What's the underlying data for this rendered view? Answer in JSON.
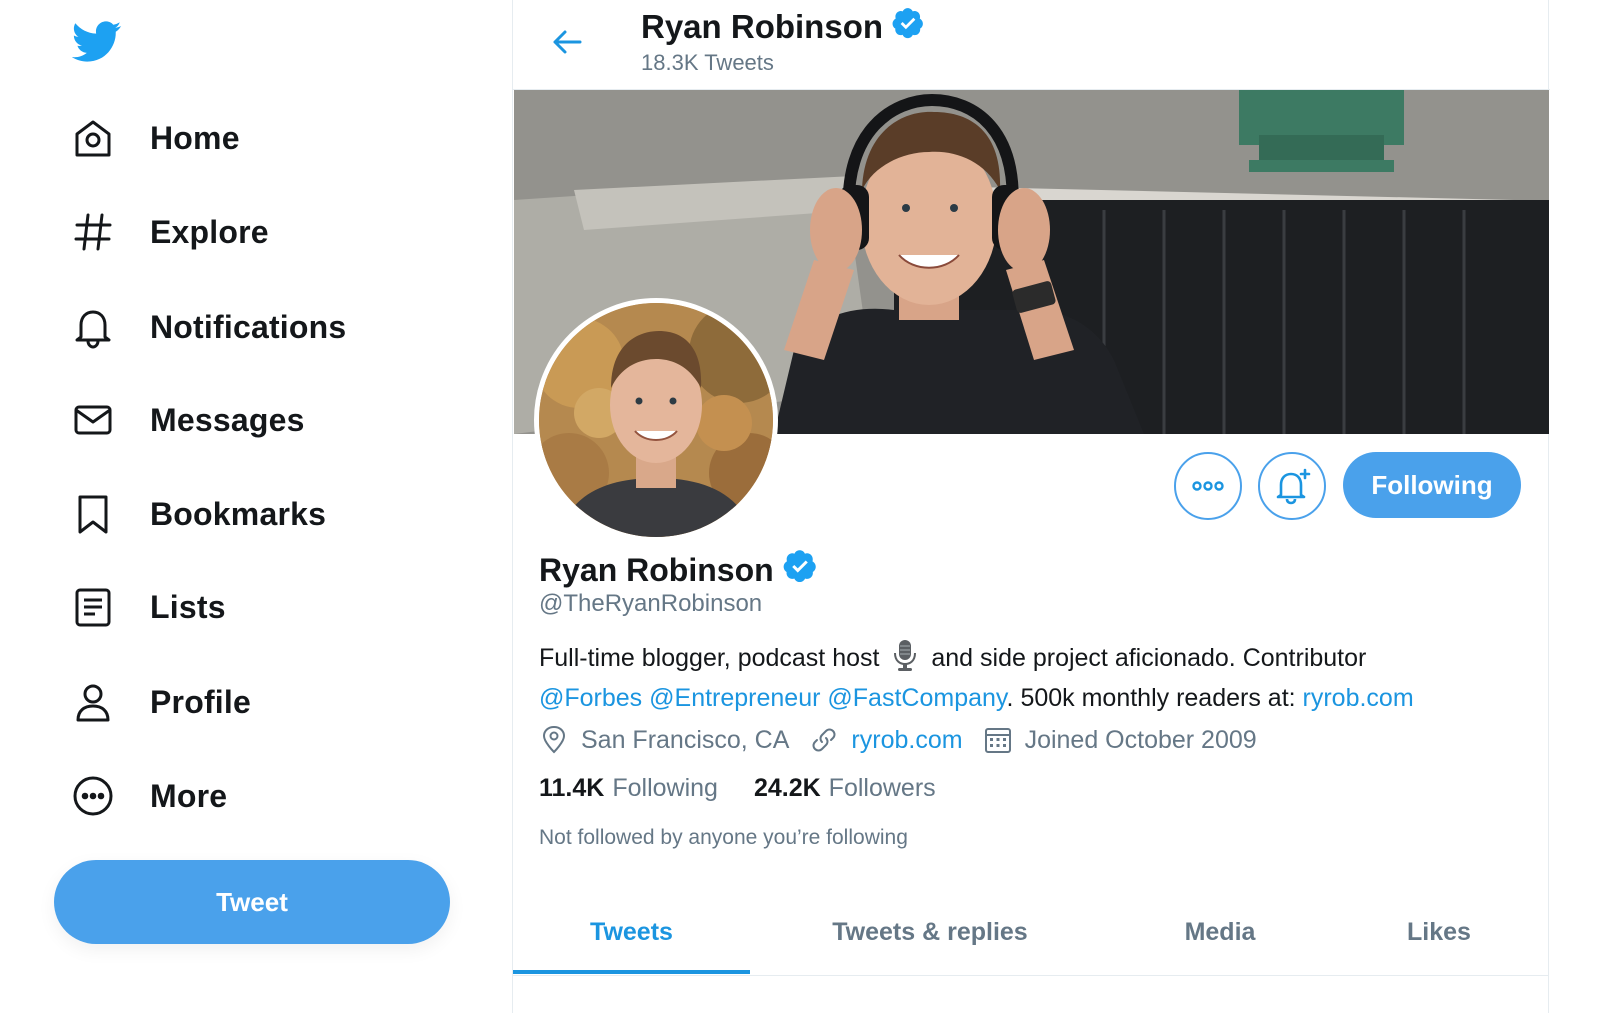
{
  "nav": {
    "items": [
      {
        "label": "Home",
        "icon": "home-icon"
      },
      {
        "label": "Explore",
        "icon": "hashtag-icon"
      },
      {
        "label": "Notifications",
        "icon": "bell-icon"
      },
      {
        "label": "Messages",
        "icon": "envelope-icon"
      },
      {
        "label": "Bookmarks",
        "icon": "bookmark-icon"
      },
      {
        "label": "Lists",
        "icon": "list-icon"
      },
      {
        "label": "Profile",
        "icon": "person-icon"
      },
      {
        "label": "More",
        "icon": "more-circle-icon"
      }
    ],
    "tweet_label": "Tweet"
  },
  "header": {
    "name": "Ryan Robinson",
    "tweet_count": "18.3K Tweets"
  },
  "profile": {
    "name": "Ryan Robinson",
    "handle": "@TheRyanRobinson",
    "following_button": "Following",
    "bio": {
      "line1_part1": "Full-time blogger, podcast host",
      "line1_part2": "and side project aficionado. Contributor",
      "mention1": "@Forbes",
      "mention2": "@Entrepreneur",
      "mention3": "@FastCompany",
      "line2_text": ". 500k monthly readers at: ",
      "link": "ryrob.com"
    },
    "location": "San Francisco, CA",
    "website": "ryrob.com",
    "joined": "Joined October 2009",
    "following_count": "11.4K",
    "following_label": "Following",
    "followers_count": "24.2K",
    "followers_label": "Followers",
    "followed_by": "Not followed by anyone you’re following"
  },
  "tabs": [
    {
      "label": "Tweets",
      "active": true
    },
    {
      "label": "Tweets & replies",
      "active": false
    },
    {
      "label": "Media",
      "active": false
    },
    {
      "label": "Likes",
      "active": false
    }
  ],
  "colors": {
    "accent": "#1b95e0",
    "button": "#4aa1eb",
    "text": "#14171a",
    "muted": "#657786"
  }
}
